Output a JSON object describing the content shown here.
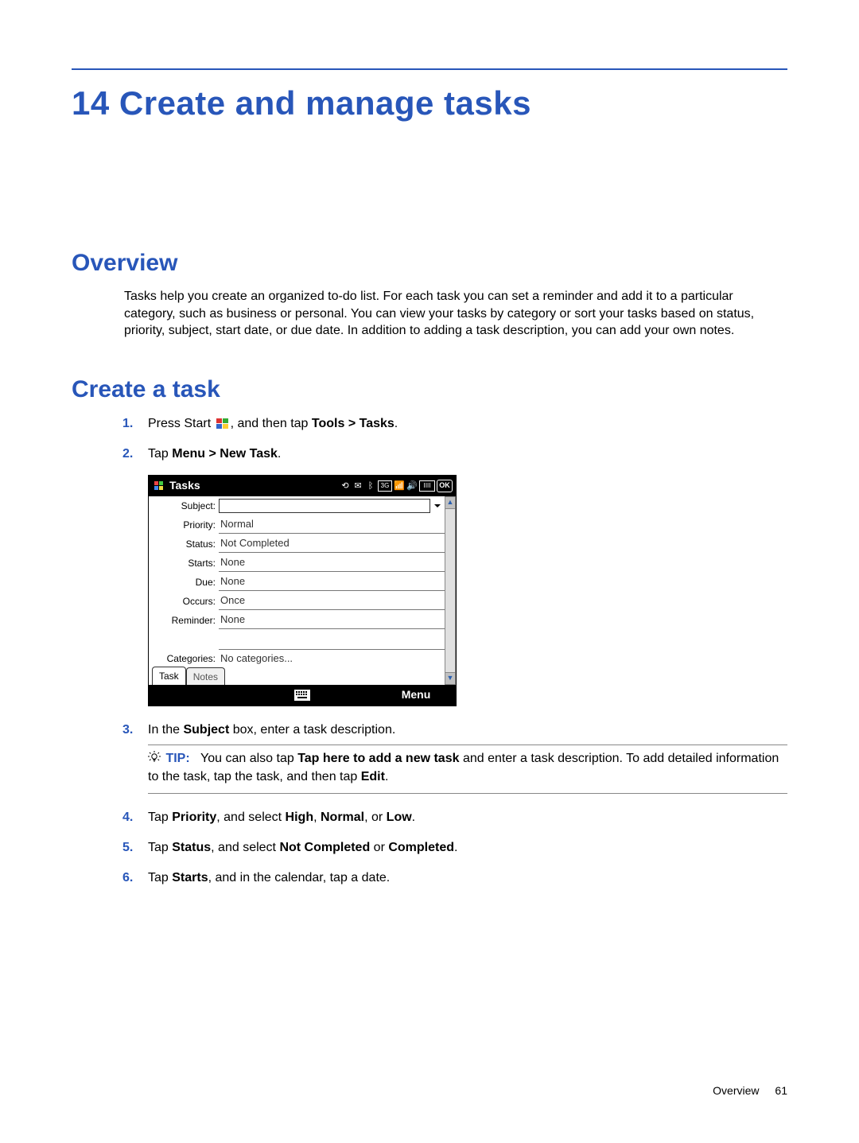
{
  "chapter": {
    "number": "14",
    "title": "Create and manage tasks"
  },
  "overview": {
    "heading": "Overview",
    "body": "Tasks help you create an organized to-do list. For each task you can set a reminder and add it to a particular category, such as business or personal. You can view your tasks by category or sort your tasks based on status, priority, subject, start date, or due date. In addition to adding a task description, you can add your own notes."
  },
  "create": {
    "heading": "Create a task",
    "steps": {
      "1": {
        "num": "1.",
        "a": "Press Start ",
        "b": ", and then tap ",
        "bold": "Tools > Tasks",
        "c": "."
      },
      "2": {
        "num": "2.",
        "a": "Tap ",
        "bold": "Menu > New Task",
        "b": "."
      },
      "3": {
        "num": "3.",
        "a": "In the ",
        "bold": "Subject",
        "b": " box, enter a task description."
      },
      "4": {
        "num": "4.",
        "a": "Tap ",
        "bold1": "Priority",
        "b": ", and select ",
        "bold2": "High",
        "c": ", ",
        "bold3": "Normal",
        "d": ", or ",
        "bold4": "Low",
        "e": "."
      },
      "5": {
        "num": "5.",
        "a": "Tap ",
        "bold1": "Status",
        "b": ", and select ",
        "bold2": "Not Completed",
        "c": " or ",
        "bold3": "Completed",
        "d": "."
      },
      "6": {
        "num": "6.",
        "a": "Tap ",
        "bold1": "Starts",
        "b": ", and in the calendar, tap a date."
      }
    },
    "tip": {
      "label": "TIP:",
      "a": "You can also tap ",
      "bold1": "Tap here to add a new task",
      "b": " and enter a task description. To add detailed information to the task, tap the task, and then tap ",
      "bold2": "Edit",
      "c": "."
    }
  },
  "screenshot": {
    "title": "Tasks",
    "menu": "Menu",
    "ok": "OK",
    "tabs": {
      "task": "Task",
      "notes": "Notes"
    },
    "rows": {
      "subject": {
        "label": "Subject:",
        "value": ""
      },
      "priority": {
        "label": "Priority:",
        "value": "Normal"
      },
      "status": {
        "label": "Status:",
        "value": "Not Completed"
      },
      "starts": {
        "label": "Starts:",
        "value": "None"
      },
      "due": {
        "label": "Due:",
        "value": "None"
      },
      "occurs": {
        "label": "Occurs:",
        "value": "Once"
      },
      "reminder": {
        "label": "Reminder:",
        "value": "None"
      },
      "categories": {
        "label": "Categories:",
        "value": "No categories..."
      }
    }
  },
  "footer": {
    "section": "Overview",
    "page": "61"
  }
}
